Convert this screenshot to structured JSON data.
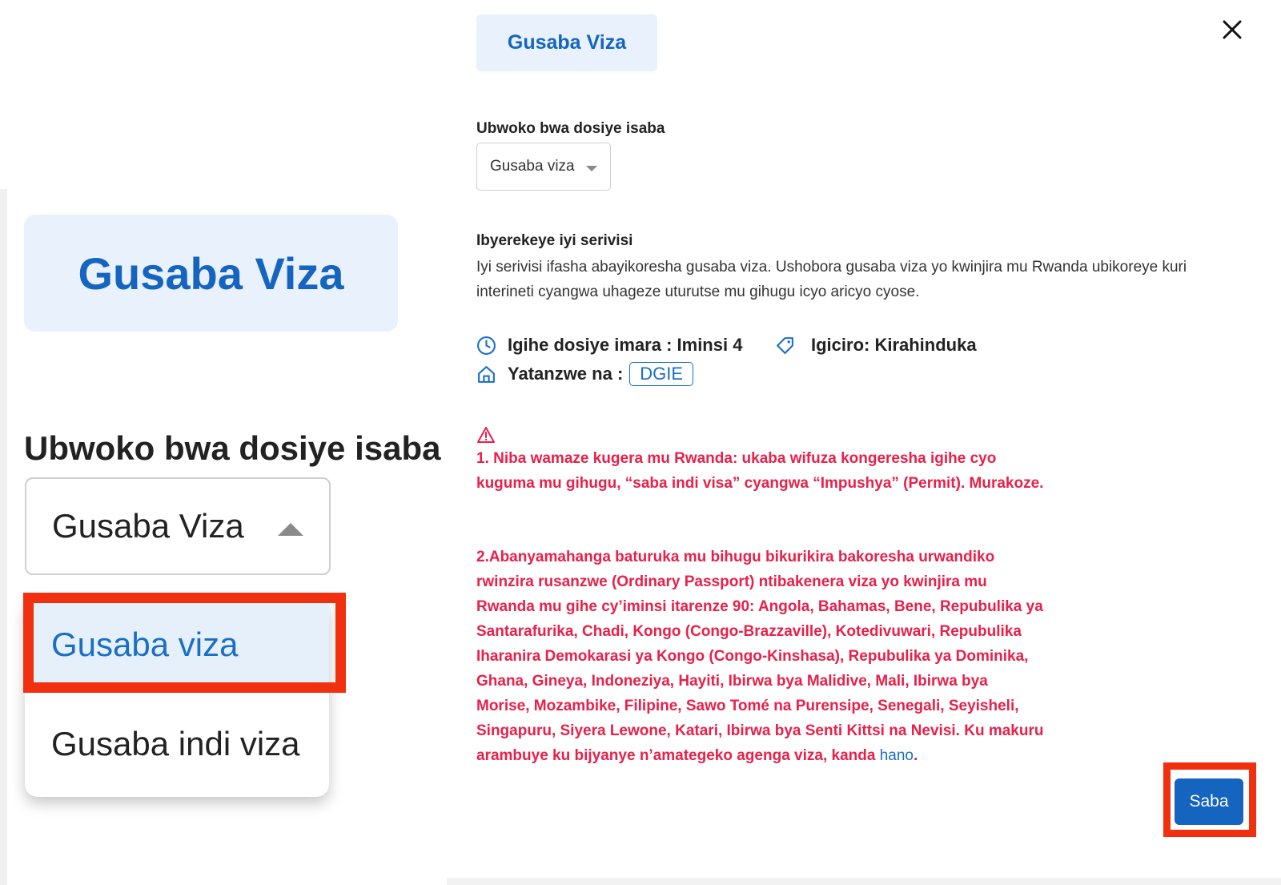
{
  "zoom": {
    "service_button": "Gusaba Viza",
    "field_label": "Ubwoko bwa dosiye isaba",
    "select_value": "Gusaba Viza",
    "options": [
      "Gusaba viza",
      "Gusaba indi viza"
    ]
  },
  "modal": {
    "service_chip": "Gusaba Viza",
    "field_label": "Ubwoko bwa dosiye isaba",
    "select_value": "Gusaba viza",
    "about_title": "Ibyerekeye iyi serivisi",
    "about_text": "Iyi serivisi ifasha abayikoresha gusaba viza. Ushobora gusaba viza yo kwinjira mu Rwanda ubikoreye kuri interineti cyangwa uhageze uturutse mu gihugu icyo aricyo cyose.",
    "duration": "Igihe dosiye imara : Iminsi 4",
    "price": "Igiciro: Kirahinduka",
    "provider_label": "Yatanzwe na :",
    "provider": "DGIE",
    "warning_1": "1. Niba wamaze kugera mu Rwanda: ukaba wifuza kongeresha igihe cyo kuguma mu gihugu, “saba indi visa” cyangwa “Impushya” (Permit). Murakoze.",
    "warning_2": "2.Abanyamahanga baturuka mu bihugu bikurikira bakoresha urwandiko rwinzira rusanzwe (Ordinary Passport) ntibakenera viza yo kwinjira mu Rwanda mu gihe cy’iminsi itarenze 90: Angola, Bahamas, Bene, Repubulika ya Santarafurika, Chadi, Kongo (Congo-Brazzaville), Kotedivuwari, Repubulika Iharanira Demokarasi ya Kongo (Congo-Kinshasa), Repubulika ya Dominika, Ghana, Gineya, Indoneziya, Hayiti, Ibirwa bya Malidive, Mali, Ibirwa bya Morise, Mozambike, Filipine, Sawo Tomé na Purensipe, Senegali, Seyisheli, Singapuru, Siyera Lewone, Katari, Ibirwa bya Senti Kittsi na Nevisi. Ku makuru arambuye ku bijyanye n’amategeko agenga viza, kanda",
    "warning_link": "hano",
    "warning_end": ".",
    "submit_label": "Saba"
  },
  "colors": {
    "accent": "#1565c0",
    "chip_bg": "#e8f1fc",
    "warning": "#e8204a",
    "highlight": "#f0300e"
  },
  "icons": [
    "close-icon",
    "clock-icon",
    "tag-icon",
    "home-icon",
    "warning-icon"
  ]
}
